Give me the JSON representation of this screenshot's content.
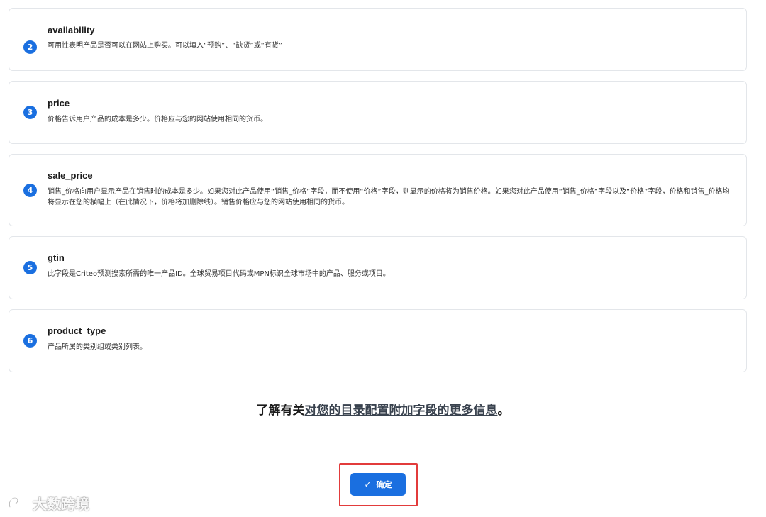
{
  "fields": [
    {
      "number": "2",
      "name": "availability",
      "description": "可用性表明产品是否可以在网站上购买。可以填入“预购”、“缺货”或“有货”"
    },
    {
      "number": "3",
      "name": "price",
      "description": "价格告诉用户产品的成本是多少。价格应与您的网站使用相同的货币。"
    },
    {
      "number": "4",
      "name": "sale_price",
      "description": "销售_价格向用户显示产品在销售时的成本是多少。如果您对此产品使用“销售_价格”字段，而不使用“价格”字段，则显示的价格将为销售价格。如果您对此产品使用“销售_价格”字段以及“价格”字段，价格和销售_价格均将显示在您的横幅上（在此情况下，价格将加删除线）。销售价格应与您的网站使用相同的货币。"
    },
    {
      "number": "5",
      "name": "gtin",
      "description": "此字段是Criteo预测搜索所需的唯一产品ID。全球贸易项目代码或MPN标识全球市场中的产品、服务或项目。"
    },
    {
      "number": "6",
      "name": "product_type",
      "description": "产品所属的类别组或类别列表。"
    }
  ],
  "more_info": {
    "prefix": "了解有关",
    "link_text": "对您的目录配置附加字段的更多信息",
    "suffix": "。"
  },
  "confirm_button": {
    "label": "确定",
    "icon": "check-icon"
  },
  "watermark": {
    "text": "大数跨境"
  },
  "colors": {
    "accent": "#1a6fe0",
    "highlight_border": "#e23b3b",
    "card_border": "#e3e6ea"
  }
}
